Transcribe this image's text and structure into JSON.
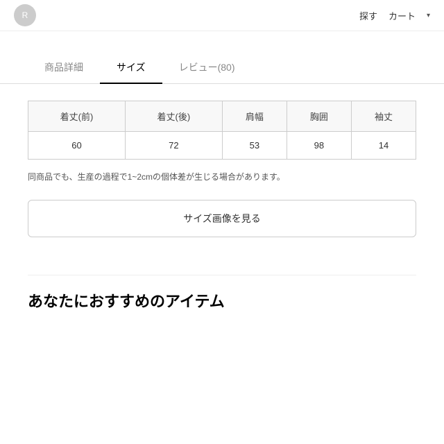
{
  "topbar": {
    "avatar_label": "R",
    "search_label": "探す",
    "cart_label": "カート",
    "chevron": "▾"
  },
  "tabs": [
    {
      "id": "details",
      "label": "商品詳細",
      "active": false
    },
    {
      "id": "size",
      "label": "サイズ",
      "active": true
    },
    {
      "id": "reviews",
      "label": "レビュー(80)",
      "active": false
    }
  ],
  "size_table": {
    "headers": [
      "着丈(前)",
      "着丈(後)",
      "肩幅",
      "胸囲",
      "袖丈"
    ],
    "rows": [
      [
        "60",
        "72",
        "53",
        "98",
        "14"
      ]
    ]
  },
  "note": "同商品でも、生産の過程で1~2cmの個体差が生じる場合があります。",
  "size_image_button": "サイズ画像を見る",
  "recommendation_heading": "あなたにおすすめのアイテム"
}
